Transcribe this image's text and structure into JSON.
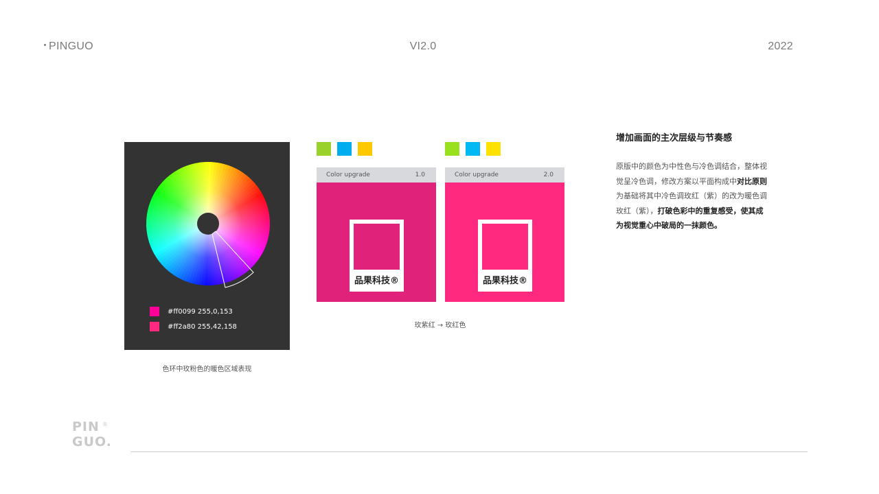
{
  "header": {
    "brand": "PINGUO",
    "version": "VI2.0",
    "year": "2022"
  },
  "wheel_panel": {
    "background": "#333333",
    "legend": [
      {
        "color": "#ff0099",
        "text": "#ff0099 255,0,153"
      },
      {
        "color": "#ff2a80",
        "text": "#ff2a80 255,42,158"
      }
    ],
    "caption": "色环中玫粉色的暖色区域表现"
  },
  "mini_swatches_left": [
    "#9ad22b",
    "#00aeef",
    "#ffc900"
  ],
  "mini_swatches_right": [
    "#9be01e",
    "#00b9f2",
    "#ffe100"
  ],
  "cards": [
    {
      "label": "Color upgrade",
      "version": "1.0",
      "color": "#e0227a",
      "chip_color": "#e0227a",
      "chip_label": "品果科技®"
    },
    {
      "label": "Color upgrade",
      "version": "2.0",
      "color": "#ff2a80",
      "chip_color": "#ff2a80",
      "chip_label": "品果科技®"
    }
  ],
  "cards_caption": "玫紫红 → 玫红色",
  "right_text": {
    "title": "增加画面的主次层级与节奏感",
    "p1": "原版中的颜色为中性色与冷色调结合，整体视觉呈冷色调，修改方案以平面构成中",
    "b1": "对比原则",
    "p2": "为基础将其中冷色调玫红（紫）的改为暖色调玫红（紫），",
    "b2": "打破色彩中的重复感受，使其成为视觉重心中破局的一抹颜色。"
  },
  "footer": {
    "logo_line1": "PIN",
    "logo_line2": "GUO.",
    "logo_reg": "®"
  }
}
